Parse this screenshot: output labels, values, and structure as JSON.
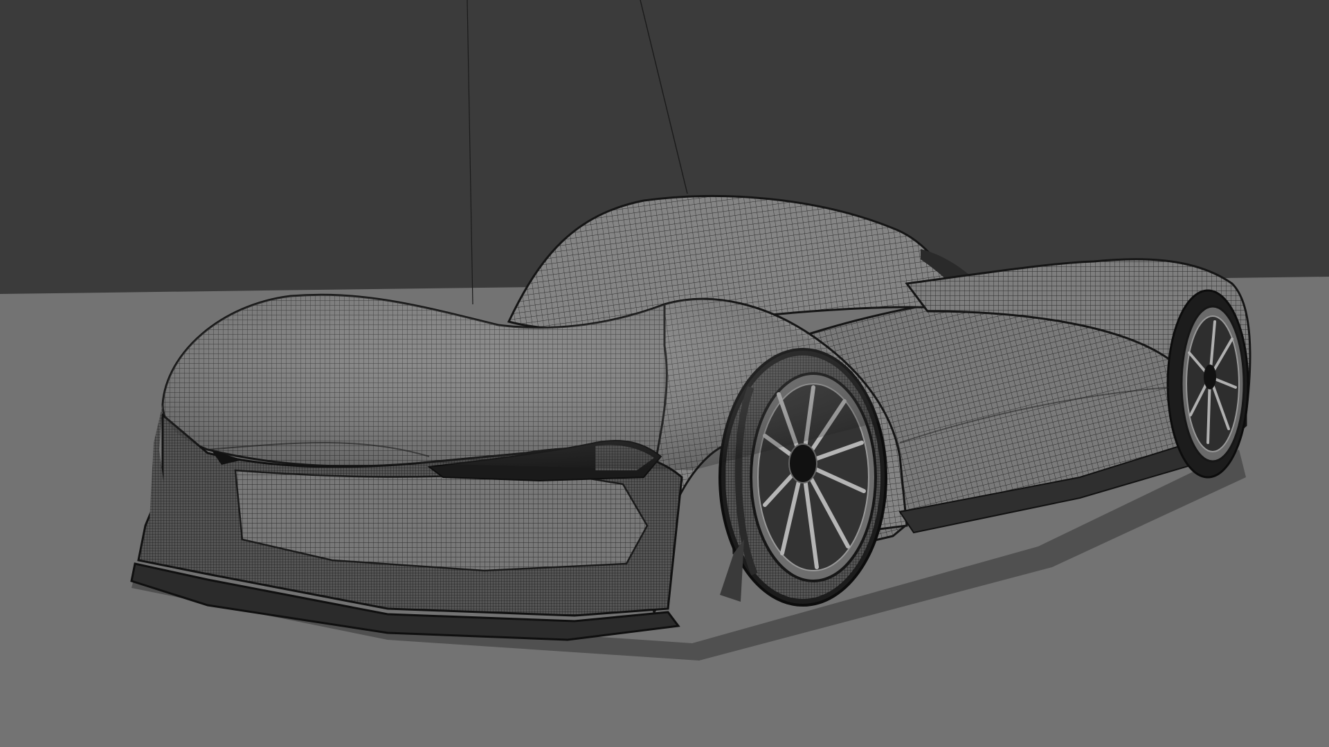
{
  "viewport": {
    "mode": "wireframe",
    "subject": "car-mesh",
    "colors": {
      "background": "#3b3b3b",
      "floor": "#737373",
      "mesh_fill": "#7e7e7e",
      "mesh_line": "#1e1e1e",
      "shadow": "#151515",
      "guide_line": "#1a1a1a"
    }
  }
}
